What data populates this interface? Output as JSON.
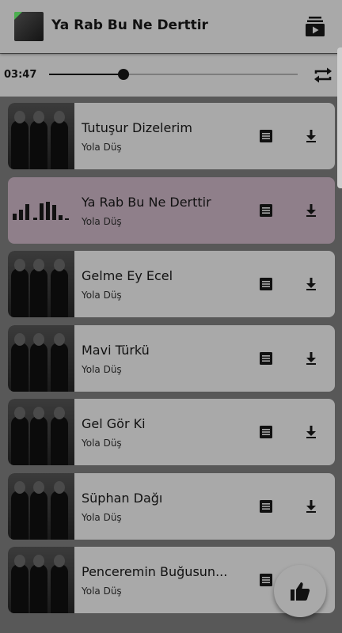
{
  "header": {
    "now_playing_title": "Ya Rab Bu Ne Derttir",
    "thumbnail_icon": "album-art",
    "queue_icon": "playlist-play-icon"
  },
  "player": {
    "elapsed_time": "03:47",
    "progress": 0.3,
    "repeat_icon": "repeat-icon"
  },
  "songs": [
    {
      "title": "Tutuşur Dizelerim",
      "artist": "Yola Düş",
      "playing": false
    },
    {
      "title": "Ya Rab Bu Ne Derttir",
      "artist": "Yola Düş",
      "playing": true
    },
    {
      "title": "Gelme Ey Ecel",
      "artist": "Yola Düş",
      "playing": false
    },
    {
      "title": "Mavi Türkü",
      "artist": "Yola Düş",
      "playing": false
    },
    {
      "title": "Gel Gör Ki",
      "artist": "Yola Düş",
      "playing": false
    },
    {
      "title": "Süphan Dağı",
      "artist": "Yola Düş",
      "playing": false
    },
    {
      "title": "Penceremin Buğusun...",
      "artist": "Yola Düş",
      "playing": false
    }
  ],
  "fab": {
    "icon": "thumbs-up-icon"
  },
  "colors": {
    "background": "#585858",
    "card": "#a9a9a9",
    "playing_card": "#8f7f8a"
  }
}
